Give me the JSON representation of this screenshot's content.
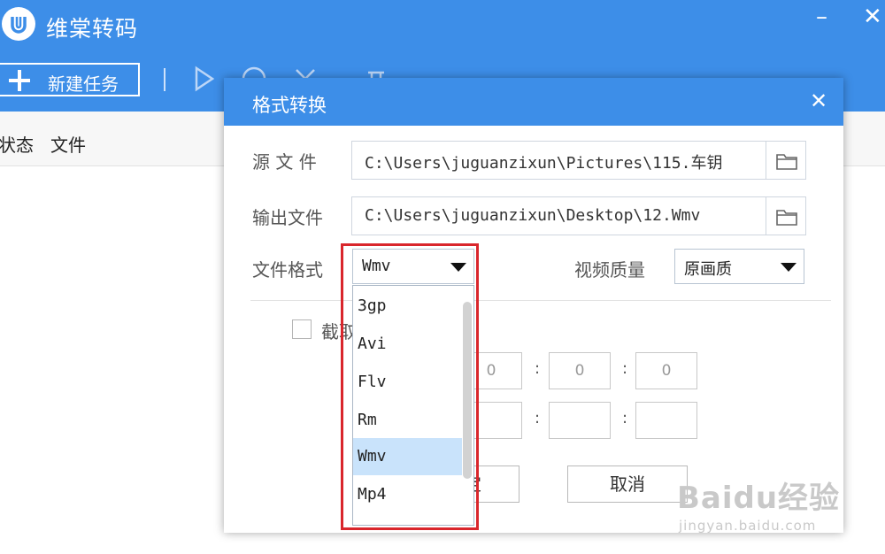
{
  "app": {
    "title": "维棠转码",
    "minimize_glyph": "–",
    "close_glyph": "✕"
  },
  "toolbar": {
    "new_task_label": "新建任务",
    "icons": [
      "play-icon",
      "stop-icon",
      "delete-icon",
      "clear-icon"
    ]
  },
  "list": {
    "columns": [
      "状态",
      "文件"
    ]
  },
  "dialog": {
    "title": "格式转换",
    "close_glyph": "✕",
    "source_label": "源 文 件",
    "source_path": "C:\\Users\\juguanzixun\\Pictures\\115.车钥",
    "output_label": "输出文件",
    "output_path": "C:\\Users\\juguanzixun\\Desktop\\12.Wmv",
    "format_label": "文件格式",
    "format_value": "Wmv",
    "quality_label": "视频质量",
    "quality_value": "原画质",
    "clip_label": "截取",
    "start_time": [
      "0",
      "0",
      "0"
    ],
    "end_time": [
      "",
      "",
      ""
    ],
    "confirm_label": "定",
    "cancel_label": "取消"
  },
  "dropdown": {
    "options": [
      "3gp",
      "Avi",
      "Flv",
      "Rm",
      "Wmv",
      "Mp4"
    ],
    "selected": "Wmv"
  },
  "colors": {
    "accent": "#3d8ee8",
    "highlight_frame": "#d9262c",
    "selected_row": "#c9e3fb"
  },
  "watermark": {
    "logo": "Baidu经验",
    "url": "jingyan.baidu.com"
  }
}
